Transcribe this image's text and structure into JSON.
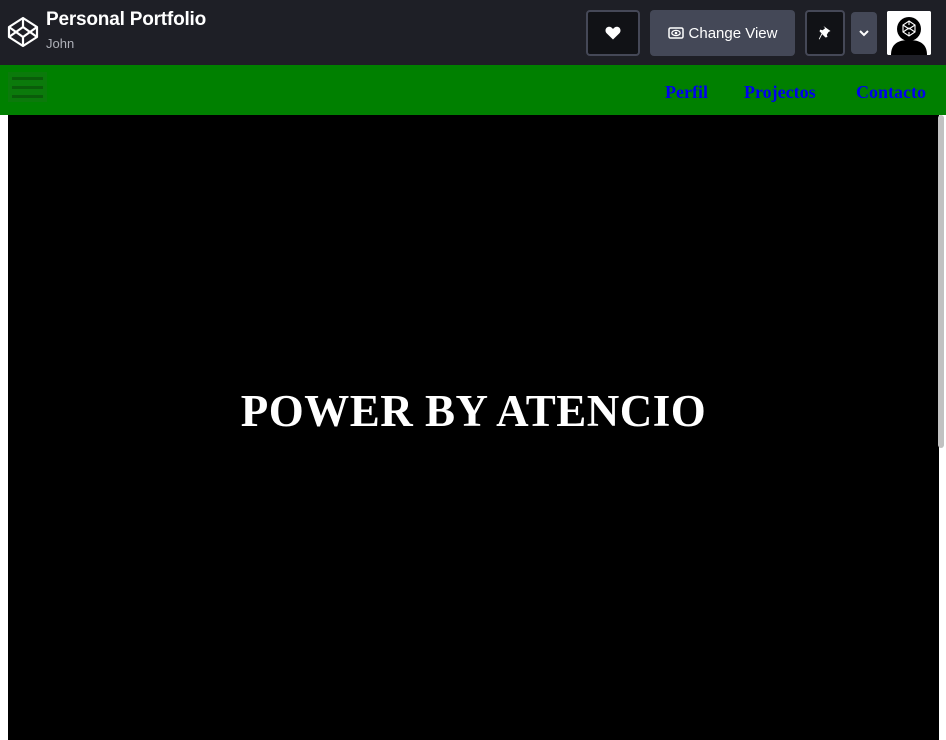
{
  "codepen": {
    "pen_title": "Personal Portfolio",
    "author": "John",
    "change_view_label": "Change View",
    "icons": [
      "codepen-logo-icon",
      "heart-icon",
      "eye-icon",
      "pin-icon",
      "chevron-down-icon",
      "avatar-icon"
    ]
  },
  "site": {
    "nav": {
      "links": [
        "Perfil",
        "Projectos",
        "Contacto"
      ]
    },
    "hero": {
      "text": "POWER BY ATENCIO"
    }
  },
  "colors": {
    "topbar_bg": "#1e1f26",
    "navbar_bg": "#008000",
    "nav_link": "#0000ee",
    "hero_bg": "#000000",
    "hero_text": "#ffffff"
  }
}
